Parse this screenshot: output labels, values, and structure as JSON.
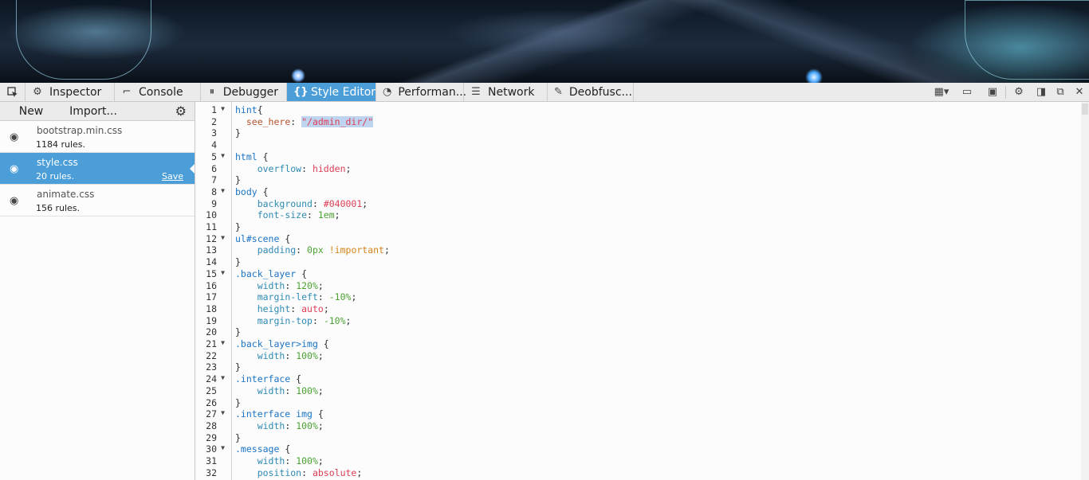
{
  "toolbar": {
    "tabs": [
      {
        "label": "Inspector",
        "icon": "inspector-icon"
      },
      {
        "label": "Console",
        "icon": "console-icon"
      },
      {
        "label": "Debugger",
        "icon": "debugger-icon"
      },
      {
        "label": "Style Editor",
        "icon": "braces-icon"
      },
      {
        "label": "Performan...",
        "icon": "performance-icon"
      },
      {
        "label": "Network",
        "icon": "network-icon"
      },
      {
        "label": "Deobfusc...",
        "icon": "deobfuscator-icon"
      }
    ],
    "active_tab": "Style Editor",
    "accent": "#4c9ed9"
  },
  "sidebar": {
    "new_label": "New",
    "import_label": "Import...",
    "sheets": [
      {
        "name": "bootstrap.min.css",
        "rules": "1184 rules."
      },
      {
        "name": "style.css",
        "rules": "20 rules.",
        "save": "Save"
      },
      {
        "name": "animate.css",
        "rules": "156 rules."
      }
    ]
  },
  "editor": {
    "lines": [
      "hint{",
      "  see_here: \"/admin_dir/\"",
      "}",
      "",
      "html {",
      "    overflow: hidden;",
      "}",
      "body {",
      "    background: #040001;",
      "    font-size: 1em;",
      "}",
      "ul#scene {",
      "    padding: 0px !important;",
      "}",
      ".back_layer {",
      "    width: 120%;",
      "    margin-left: -10%;",
      "    height: auto;",
      "    margin-top: -10%;",
      "}",
      ".back_layer>img {",
      "    width: 100%;",
      "}",
      ".interface {",
      "    width: 100%;",
      "}",
      ".interface img {",
      "    width: 100%;",
      "}",
      ".message {",
      "    width: 100%;",
      "    position: absolute;"
    ],
    "line_numbers": [
      "1",
      "2",
      "3",
      "4",
      "5",
      "6",
      "7",
      "8",
      "9",
      "10",
      "11",
      "12",
      "13",
      "14",
      "15",
      "16",
      "17",
      "18",
      "19",
      "20",
      "21",
      "22",
      "23",
      "24",
      "25",
      "26",
      "27",
      "28",
      "29",
      "30",
      "31",
      "32"
    ]
  }
}
